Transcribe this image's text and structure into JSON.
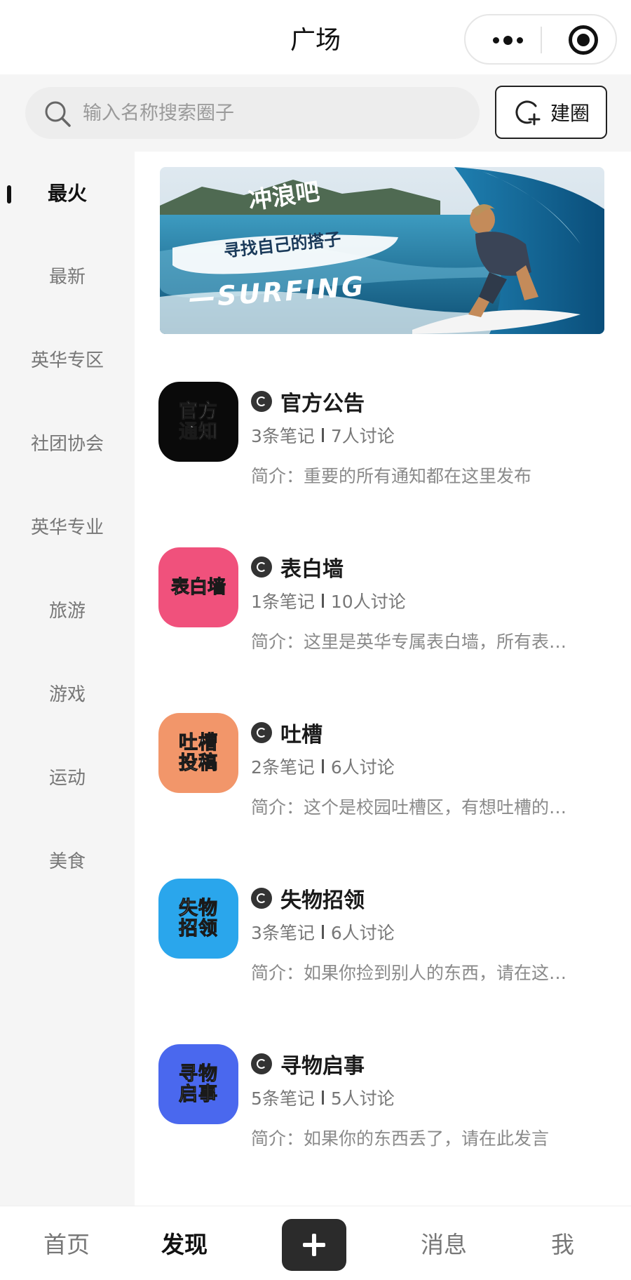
{
  "header": {
    "title": "广场"
  },
  "search": {
    "placeholder": "输入名称搜索圈子",
    "create_label": "建圈"
  },
  "sidebar": {
    "items": [
      {
        "label": "最火",
        "active": true
      },
      {
        "label": "最新"
      },
      {
        "label": "英华专区"
      },
      {
        "label": "社团协会"
      },
      {
        "label": "英华专业"
      },
      {
        "label": "旅游"
      },
      {
        "label": "游戏"
      },
      {
        "label": "运动"
      },
      {
        "label": "美食"
      }
    ]
  },
  "banner": {
    "headline": "冲浪吧",
    "subline": "寻找自己的搭子",
    "tag": "—SURFING"
  },
  "circles": [
    {
      "avatar_lines": [
        "官方",
        "通知"
      ],
      "avatar_color": "#0a0a0a",
      "name": "官方公告",
      "notes": "3条笔记",
      "discussions": "7人讨论",
      "intro": "简介：重要的所有通知都在这里发布"
    },
    {
      "avatar_lines": [
        "表白墙"
      ],
      "avatar_color": "#f0517c",
      "name": "表白墙",
      "notes": "1条笔记",
      "discussions": "10人讨论",
      "intro": "简介：这里是英华专属表白墙，所有表…"
    },
    {
      "avatar_lines": [
        "吐槽",
        "投稿"
      ],
      "avatar_color": "#f2966a",
      "name": "吐槽",
      "notes": "2条笔记",
      "discussions": "6人讨论",
      "intro": "简介：这个是校园吐槽区，有想吐槽的…"
    },
    {
      "avatar_lines": [
        "失物",
        "招领"
      ],
      "avatar_color": "#2aa6ec",
      "name": "失物招领",
      "notes": "3条笔记",
      "discussions": "6人讨论",
      "intro": "简介：如果你捡到别人的东西，请在这…"
    },
    {
      "avatar_lines": [
        "寻物",
        "启事"
      ],
      "avatar_color": "#4a68ee",
      "name": "寻物启事",
      "notes": "5条笔记",
      "discussions": "5人讨论",
      "intro": "简介：如果你的东西丢了，请在此发言"
    }
  ],
  "tabbar": {
    "home": "首页",
    "discover": "发现",
    "messages": "消息",
    "me": "我"
  },
  "icons": {
    "search": "search-icon",
    "create": "create-circle-icon",
    "more": "more-icon",
    "target": "target-icon",
    "add": "plus-icon"
  }
}
